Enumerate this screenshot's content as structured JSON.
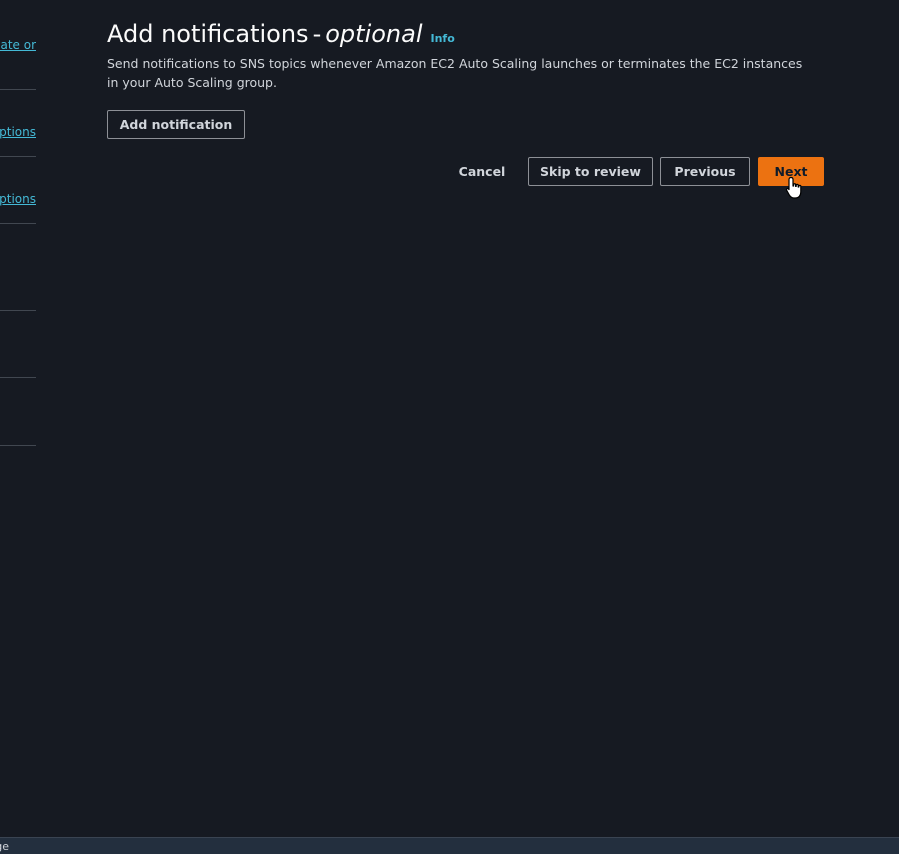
{
  "steps_nav": {
    "items": [
      {
        "label": "Choose launch template or"
      },
      {
        "label": "Choose instance launch options"
      },
      {
        "label": "Configure advanced options"
      }
    ]
  },
  "header": {
    "title_main": "Add notifications",
    "title_separator": "-",
    "title_optional": "optional",
    "info_label": "Info"
  },
  "description": "Send notifications to SNS topics whenever Amazon EC2 Auto Scaling launches or terminates the EC2 instances in your Auto Scaling group.",
  "buttons": {
    "add_notification": "Add notification",
    "cancel": "Cancel",
    "skip_to_review": "Skip to review",
    "previous": "Previous",
    "next": "Next"
  },
  "footer": {
    "text": "CloudShell Feedback Language"
  },
  "colors": {
    "background": "#161a22",
    "accent": "#ec7211",
    "link": "#44b9d6"
  }
}
